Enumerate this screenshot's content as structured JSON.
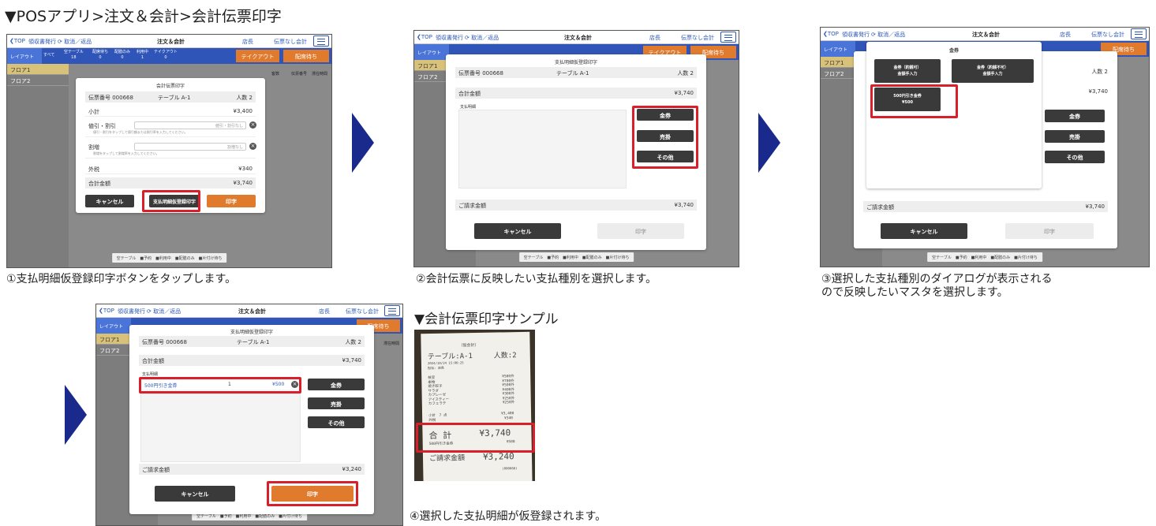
{
  "page": {
    "title": "▼POSアプリ>注文＆会計>会計伝票印字",
    "sample_title": "▼会計伝票印字サンプル"
  },
  "common": {
    "top": "TOP",
    "receipt_issue": "領収書発行",
    "cancel_return": "取消／返品",
    "header_title": "注文＆会計",
    "store": "店長",
    "no_slip": "伝票なし会計",
    "layout_tab": "レイアウト",
    "all": "すべて",
    "empty_table": "空テーブル",
    "empty_count": "18",
    "waiting_serve": "配席待ち",
    "waiting_count": "0",
    "delivery_only": "配膳のみ",
    "delivery_count": "0",
    "in_use": "利用中",
    "in_use_count": "1",
    "takeout": "テイクアウト",
    "takeout_count": "0",
    "takeout_btn": "テイクアウト",
    "wait_btn": "配席待ち",
    "floor1": "フロア1",
    "floor2": "フロア2",
    "col_persons": "客数",
    "col_slip": "伝票番号",
    "col_stay": "滞在時間",
    "legend_empty": "空テーブル",
    "legend_reserve": "予約",
    "legend_inuse": "利用中",
    "legend_delivery": "配膳のみ",
    "legend_clean": "片付け待ち",
    "slip_no": "伝票番号 000668",
    "table": "テーブル A-1",
    "persons": "人数 2",
    "cancel": "キャンセル",
    "print": "印字"
  },
  "step1": {
    "dialog_title": "会計伝票印字",
    "subtotal_label": "小計",
    "subtotal": "¥3,400",
    "discount_label": "値引・割引",
    "discount_placeholder": "値引・割引なし",
    "discount_hint": "値引・割引をタップして値引額または割引率を入力してください。",
    "surcharge_label": "割増",
    "surcharge_placeholder": "割増なし",
    "surcharge_hint": "割増をタップして割増率を入力してください。",
    "outer_tax_label": "外税",
    "outer_tax": "¥340",
    "total_label": "合計金額",
    "total": "¥3,740",
    "temp_print_btn": "支払明細仮登録印字",
    "caption": "①支払明細仮登録印字ボタンをタップします。"
  },
  "step2": {
    "dialog_title": "支払明細仮登録印字",
    "total_label": "合計金額",
    "total": "¥3,740",
    "details_label": "支払明細",
    "btn_voucher": "金券",
    "btn_credit": "売掛",
    "btn_other": "その他",
    "billed_label": "ご請求金額",
    "billed": "¥3,740",
    "caption": "②会計伝票に反映したい支払種別を選択します。"
  },
  "step3": {
    "dialog_title": "金券",
    "opt1_line1": "金券（釣銭可）",
    "opt1_line2": "金額手入力",
    "opt2_line1": "金券（釣銭不可）",
    "opt2_line2": "金額手入力",
    "opt3_line1": "500円引き金券",
    "opt3_line2": "¥500",
    "persons": "人数 2",
    "total": "¥3,740",
    "btn_voucher": "金券",
    "btn_credit": "売掛",
    "btn_other": "その他",
    "billed_label": "ご請求金額",
    "billed": "¥3,740",
    "caption_line1": "③選択した支払種別のダイアログが表示される",
    "caption_line2": "ので反映したいマスタを選択します。"
  },
  "step4": {
    "dialog_title": "支払明細仮登録印字",
    "total_label": "合計金額",
    "total": "¥3,740",
    "details_label": "支払明細",
    "item_name": "500円引き金券",
    "item_qty": "1",
    "item_amount": "¥500",
    "btn_voucher": "金券",
    "btn_credit": "売掛",
    "btn_other": "その他",
    "billed_label": "ご請求金額",
    "billed": "¥3,240",
    "caption": "④選択した支払明細が仮登録されます。"
  },
  "receipt": {
    "header": "（仮会計）",
    "table": "テーブル:A-1",
    "persons": "人数:2",
    "datetime": "2024/10/24 15:06:25",
    "staff": "担当: 店長",
    "items": [
      {
        "name": "枝豆",
        "price": "¥500外"
      },
      {
        "name": "串物",
        "price": "¥700外"
      },
      {
        "name": "焼き餃子",
        "price": "¥500外"
      },
      {
        "name": "サラダ",
        "price": "¥400外"
      },
      {
        "name": "カプレーゼ",
        "price": "¥300外"
      },
      {
        "name": "アイスティー",
        "price": "¥250外"
      },
      {
        "name": "カフェラテ",
        "price": "¥250外"
      }
    ],
    "subtotal_label": "小計　7 点",
    "subtotal": "¥3,400",
    "tax_label": "外税",
    "tax": "¥340",
    "total_label": "合 計",
    "total": "¥3,740",
    "voucher_label": "500円引き金券",
    "voucher": "¥500",
    "billed_label": "ご請求金額",
    "billed": "¥3,240",
    "slip": "(000668)"
  },
  "colors": {
    "accent_blue": "#2f55b8",
    "orange": "#e07b2e",
    "highlight_red": "#d9202a",
    "arrow_navy": "#1a2a8c",
    "dark_button": "#3a3a3a"
  }
}
